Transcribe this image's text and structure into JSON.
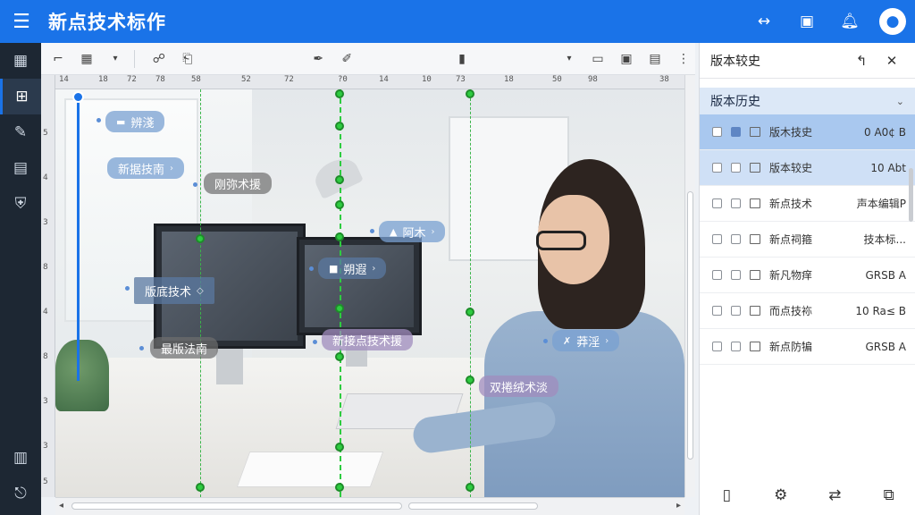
{
  "app": {
    "title": "新点技术标作"
  },
  "header": {
    "menu_icon": "hamburger-icon",
    "icons": [
      "swap-horizontal-icon",
      "cube-icon",
      "bell-icon",
      "user-avatar-icon"
    ]
  },
  "left_rail": {
    "items": [
      "dashboard-grid-icon",
      "structure-icon",
      "pencil-icon",
      "layout-icon",
      "shield-icon"
    ],
    "bottom": [
      "document-icon",
      "logout-icon"
    ]
  },
  "toolbar": {
    "items": [
      "frame-icon",
      "grid-icon",
      "chevron-down-icon",
      "link-icon",
      "clipboard-icon",
      "pen-tool-icon",
      "edit-icon",
      "book-icon",
      "chevron-down-icon",
      "screen-icon",
      "monitor-icon",
      "file-icon",
      "more-icon"
    ]
  },
  "ruler": {
    "ticks": [
      "14",
      "18",
      "72",
      "78",
      "58",
      "52",
      "72",
      "?0",
      "14",
      "10",
      "73",
      "18",
      "50",
      "98",
      "38"
    ]
  },
  "vruler": {
    "ticks": [
      "5",
      "4",
      "3",
      "8",
      "4",
      "8",
      "3",
      "3",
      "5"
    ]
  },
  "canvas": {
    "labels": [
      {
        "text": "辨淺",
        "icon": "▬"
      },
      {
        "text": "新据技南",
        "icon": ""
      },
      {
        "text": "刚弥术援",
        "icon": ""
      },
      {
        "text": "阿木",
        "icon": "▲"
      },
      {
        "text": "版底技术",
        "icon": ""
      },
      {
        "text": "朔遐",
        "icon": "■"
      },
      {
        "text": "最版法南",
        "icon": ""
      },
      {
        "text": "新接点技术援",
        "icon": ""
      },
      {
        "text": "莽淫",
        "icon": "✗"
      },
      {
        "text": "双捲绒术淡",
        "icon": ""
      }
    ]
  },
  "panel": {
    "title": "版本较史",
    "section": "版本历史",
    "versions": [
      {
        "name": "版木技史",
        "meta": "0 A0¢ B"
      },
      {
        "name": "版本较史",
        "meta": "10 Abt"
      },
      {
        "name": "新点技术",
        "meta": "声本编辑P"
      },
      {
        "name": "新点祠箍",
        "meta": "技本标..."
      },
      {
        "name": "新凡物痒",
        "meta": "GRSB A"
      },
      {
        "name": "而点技袮",
        "meta": "10 Ra≤ B"
      },
      {
        "name": "新点防犏",
        "meta": "GRSB A"
      }
    ],
    "footer": [
      "phone-icon",
      "gear-icon",
      "share-icon",
      "copy-icon"
    ]
  }
}
